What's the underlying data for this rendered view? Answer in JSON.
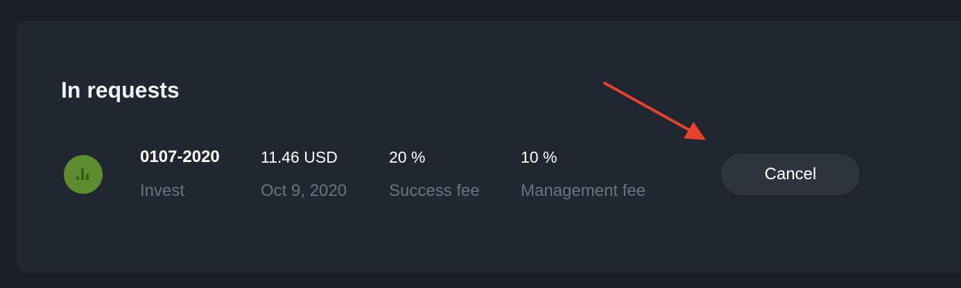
{
  "section": {
    "title": "In requests"
  },
  "request": {
    "avatar_icon": "bar-chart-icon",
    "avatar_color": "#5c8c2e",
    "name": "0107-2020",
    "type": "Invest",
    "amount": "11.46 USD",
    "date": "Oct 9, 2020",
    "success_fee_value": "20 %",
    "success_fee_label": "Success fee",
    "management_fee_value": "10 %",
    "management_fee_label": "Management fee",
    "cancel_label": "Cancel"
  },
  "annotation": {
    "arrow_icon": "red-arrow-annotation",
    "color": "#e8432a"
  }
}
